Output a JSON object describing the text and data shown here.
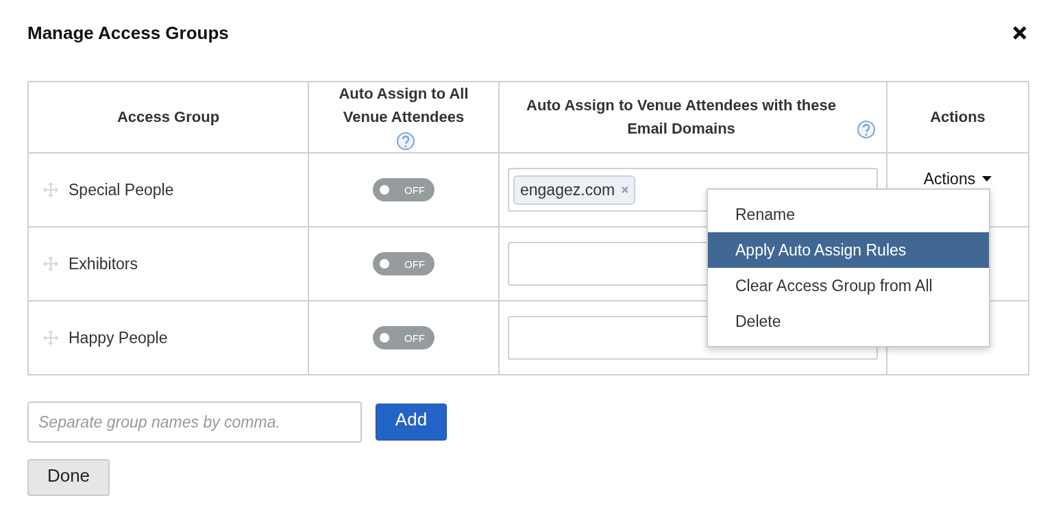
{
  "dialog": {
    "title": "Manage Access Groups"
  },
  "table": {
    "columns": [
      {
        "label": "Access Group",
        "help": false
      },
      {
        "label": "Auto Assign to All Venue Attendees",
        "help": true
      },
      {
        "label": "Auto Assign to Venue Attendees with these Email Domains",
        "help": true
      },
      {
        "label": "Actions",
        "help": false
      }
    ],
    "rows": [
      {
        "name": "Special People",
        "toggle": {
          "on": false,
          "label": "OFF"
        },
        "domains": [
          "engagez.com"
        ],
        "actions": "Actions"
      },
      {
        "name": "Exhibitors",
        "toggle": {
          "on": false,
          "label": "OFF"
        },
        "domains": []
      },
      {
        "name": "Happy People",
        "toggle": {
          "on": false,
          "label": "OFF"
        },
        "domains": []
      }
    ]
  },
  "menu": {
    "items": [
      {
        "label": "Rename",
        "selected": false
      },
      {
        "label": "Apply Auto Assign Rules",
        "selected": true
      },
      {
        "label": "Clear Access Group from All",
        "selected": false
      },
      {
        "label": "Delete",
        "selected": false
      }
    ]
  },
  "new_group": {
    "placeholder": "Separate group names by comma."
  },
  "add_button": "Add",
  "done_button": "Done"
}
